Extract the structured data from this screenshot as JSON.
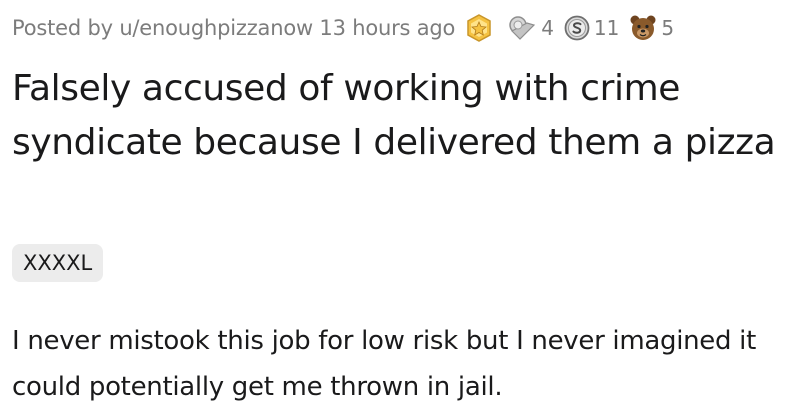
{
  "post": {
    "posted_by_prefix": "Posted by",
    "username": "u/enoughpizzanow",
    "time_ago": "13 hours ago",
    "awards": [
      {
        "icon": "gold-badge-icon",
        "count": ""
      },
      {
        "icon": "silver-award-icon",
        "count": "4"
      },
      {
        "icon": "silver-coin-icon",
        "count": "11"
      },
      {
        "icon": "bear-face-icon",
        "count": "5"
      }
    ],
    "title": "Falsely accused of working with crime syndicate because I delivered them a pizza",
    "flair": "XXXXL",
    "body": "I never mistook this job for low risk but I never imagined it could potentially get me thrown in jail."
  },
  "colors": {
    "meta_text": "#7c7c7c",
    "title_text": "#1a1a1b",
    "flair_bg": "#ececec",
    "gold": "#f5c242",
    "silver": "#b9b9b9",
    "bear": "#8a5a2b"
  }
}
